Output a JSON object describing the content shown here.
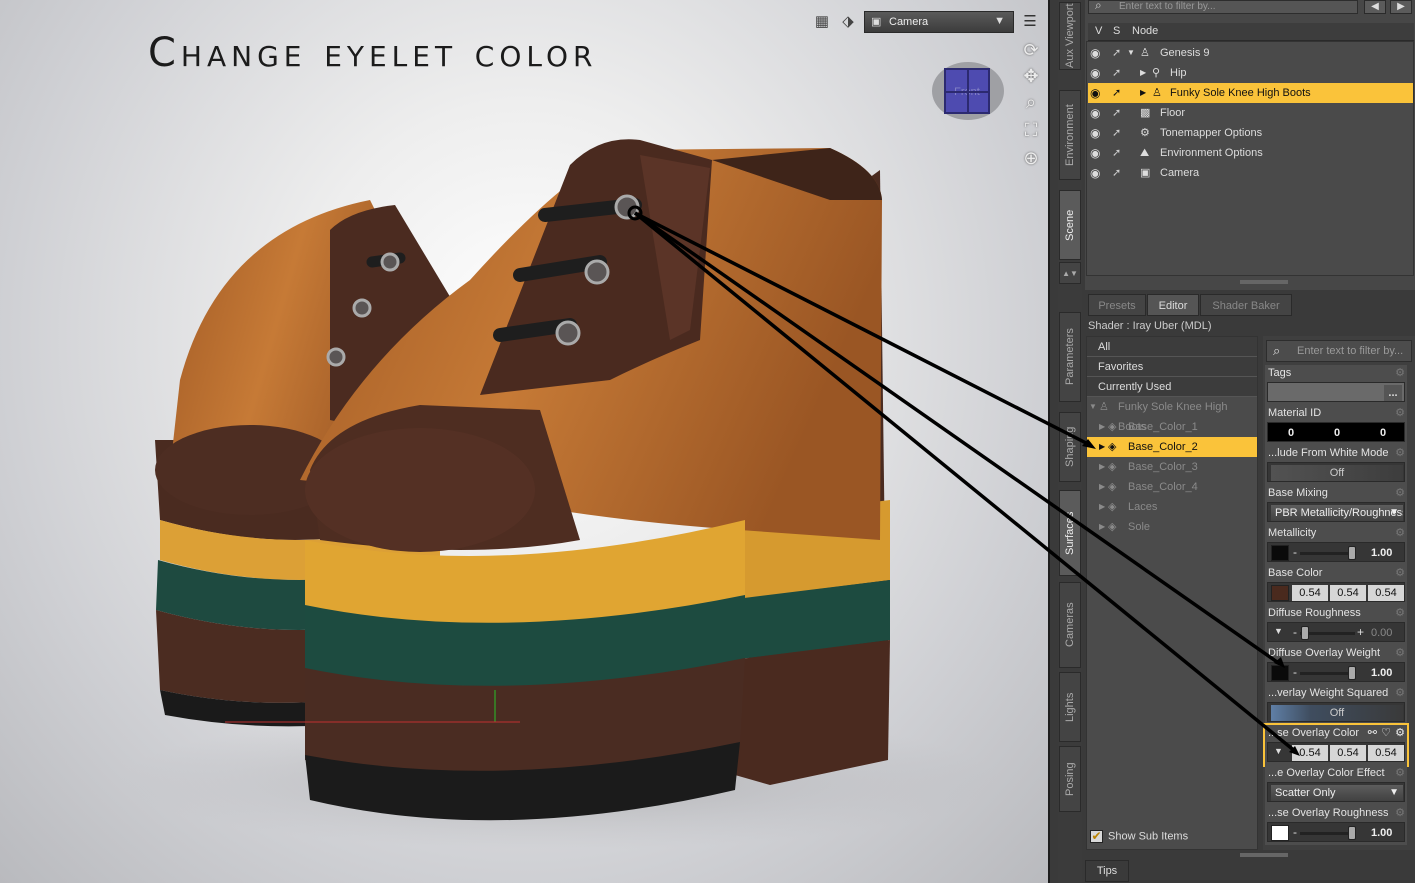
{
  "viewport": {
    "title": "Change eyelet color",
    "camera_select": "Camera",
    "navcube_face": "Front"
  },
  "side_tabs": [
    "Aux Viewport",
    "Environment",
    "Scene",
    "Parameters",
    "Shaping",
    "Surfaces",
    "Cameras",
    "Lights",
    "Posing"
  ],
  "scene": {
    "filter_placeholder": "Enter text to filter by...",
    "columns": {
      "v": "V",
      "s": "S",
      "node": "Node"
    },
    "nodes": [
      {
        "label": "Genesis 9",
        "icon": "figure-icon"
      },
      {
        "label": "Hip",
        "icon": "bone-icon"
      },
      {
        "label": "Funky Sole Knee High Boots",
        "icon": "figure-icon",
        "selected": true
      },
      {
        "label": "Floor",
        "icon": "prop-icon"
      },
      {
        "label": "Tonemapper Options",
        "icon": "options-icon"
      },
      {
        "label": "Environment Options",
        "icon": "environment-icon"
      },
      {
        "label": "Camera",
        "icon": "camera-icon"
      }
    ]
  },
  "surfaces": {
    "tabs": [
      "Presets",
      "Editor",
      "Shader Baker"
    ],
    "active_tab": "Editor",
    "shader_label": "Shader : Iray Uber (MDL)",
    "groups": [
      "All",
      "Favorites",
      "Currently Used"
    ],
    "root": "Funky Sole Knee High Boots",
    "materials": [
      "Base_Color_1",
      "Base_Color_2",
      "Base_Color_3",
      "Base_Color_4",
      "Laces",
      "Sole"
    ],
    "selected_material": "Base_Color_2",
    "show_sub_items": "Show Sub Items",
    "filter_placeholder": "Enter text to filter by...",
    "properties": {
      "tags": {
        "label": "Tags",
        "button": "..."
      },
      "material_id": {
        "label": "Material ID",
        "values": [
          "0",
          "0",
          "0"
        ]
      },
      "exclude_white": {
        "label": "...lude From White Mode",
        "value": "Off"
      },
      "base_mixing": {
        "label": "Base Mixing",
        "value": "PBR Metallicity/Roughness"
      },
      "metallicity": {
        "label": "Metallicity",
        "value": "1.00",
        "swatch": "#0a0a0a"
      },
      "base_color": {
        "label": "Base Color",
        "values": [
          "0.54",
          "0.54",
          "0.54"
        ],
        "swatch": "#4a2a1e"
      },
      "diffuse_roughness": {
        "label": "Diffuse Roughness",
        "value": "0.00"
      },
      "diffuse_overlay_weight": {
        "label": "Diffuse Overlay Weight",
        "value": "1.00",
        "swatch": "#0a0a0a"
      },
      "overlay_weight_squared": {
        "label": "...verlay Weight Squared",
        "value": "Off"
      },
      "overlay_color": {
        "label": "...se Overlay Color",
        "values": [
          "0.54",
          "0.54",
          "0.54"
        ],
        "swatch": "#0a0a0a"
      },
      "overlay_color_effect": {
        "label": "...e Overlay Color Effect",
        "value": "Scatter Only"
      },
      "overlay_roughness": {
        "label": "...se Overlay Roughness",
        "value": "1.00",
        "swatch": "#ffffff"
      }
    }
  },
  "tips_tab": "Tips",
  "colors": {
    "accent": "#fac33a",
    "leather_orange": "#b76a2c",
    "leather_brown": "#4a2c22",
    "sole_yellow": "#e0a532",
    "sole_green": "#1d4b40"
  }
}
